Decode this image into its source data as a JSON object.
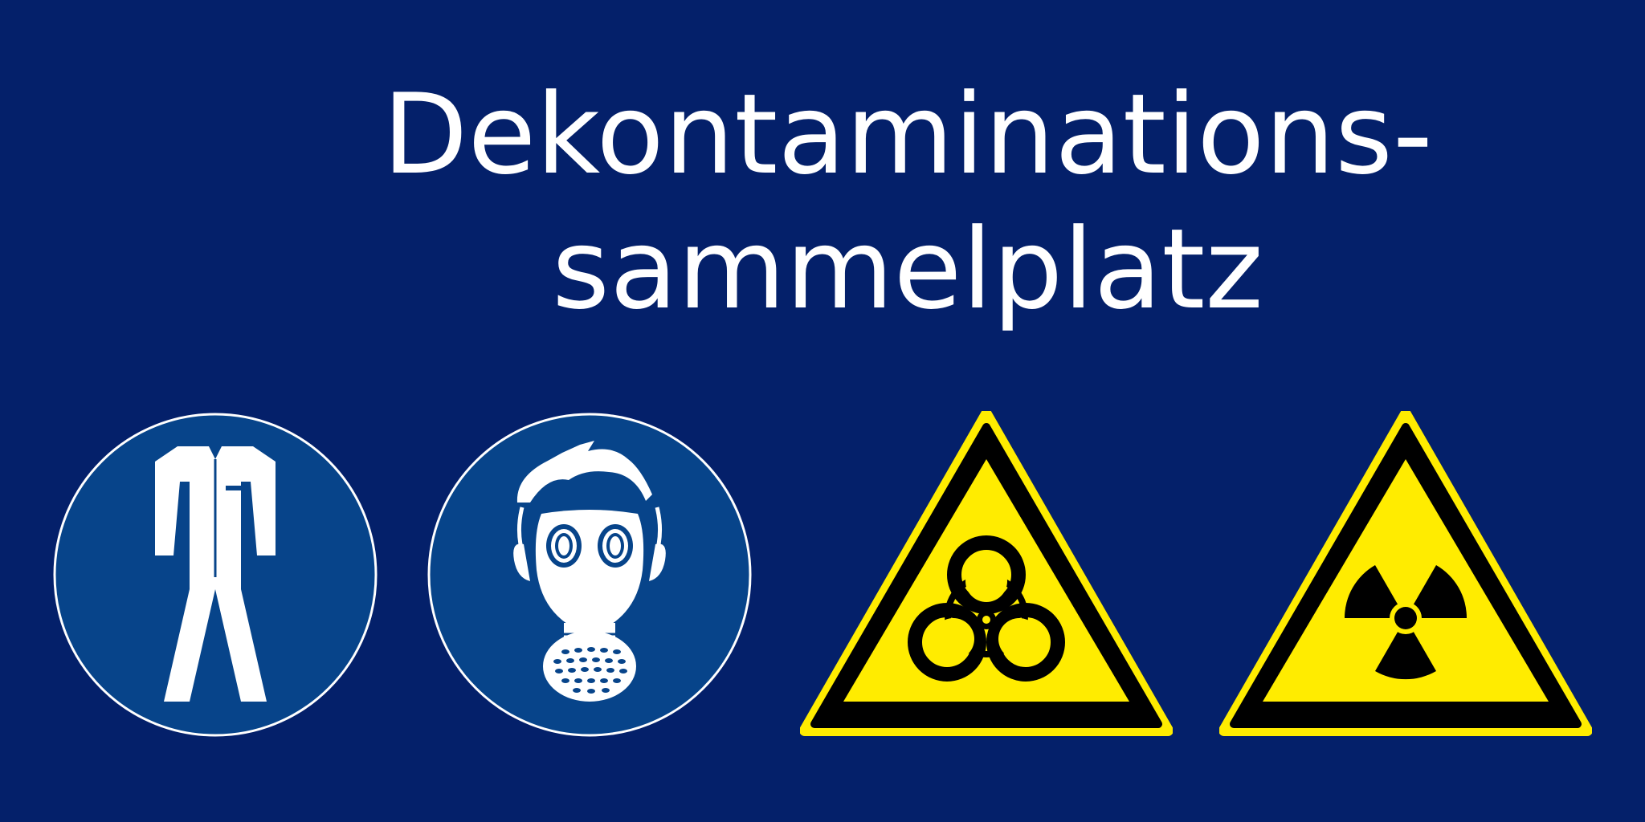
{
  "title": {
    "line1": "Dekontaminations-",
    "line2": "sammelplatz"
  },
  "colors": {
    "background": "#04206a",
    "mandatory_blue": "#07448a",
    "warning_yellow": "#ffec00",
    "black": "#000000",
    "white": "#ffffff"
  },
  "signs": [
    {
      "type": "mandatory",
      "icon": "protective-suit-icon"
    },
    {
      "type": "mandatory",
      "icon": "gas-mask-icon"
    },
    {
      "type": "warning",
      "icon": "biohazard-icon"
    },
    {
      "type": "warning",
      "icon": "radiation-icon"
    }
  ]
}
